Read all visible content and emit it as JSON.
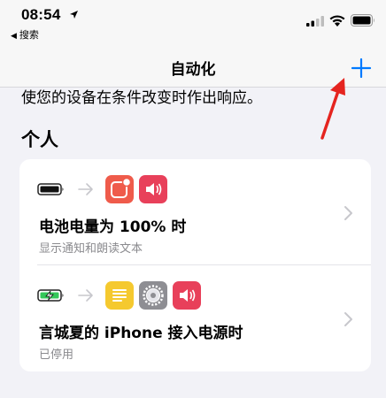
{
  "status_bar": {
    "time": "08:54",
    "back_app": "搜索"
  },
  "nav": {
    "title": "自动化"
  },
  "content": {
    "subtitle": "使您的设备在条件改变时作出响应。",
    "section_header": "个人",
    "automations": [
      {
        "title": "电池电量为 100% 时",
        "subtitle": "显示通知和朗读文本",
        "trigger_icon": "battery-full-icon",
        "action_icons": [
          "notification-icon",
          "speaker-icon"
        ]
      },
      {
        "title": "言城夏的 iPhone 接入电源时",
        "subtitle": "已停用",
        "trigger_icon": "battery-charging-icon",
        "action_icons": [
          "notes-icon",
          "settings-icon",
          "speaker-icon"
        ]
      }
    ]
  },
  "colors": {
    "accent": "#007aff",
    "annotation_red": "#e5241f",
    "notification_red": "#ef5b4b",
    "speaker_pink": "#e8405a",
    "notes_yellow": "#f5c92f",
    "settings_gray": "#8e8e93"
  }
}
